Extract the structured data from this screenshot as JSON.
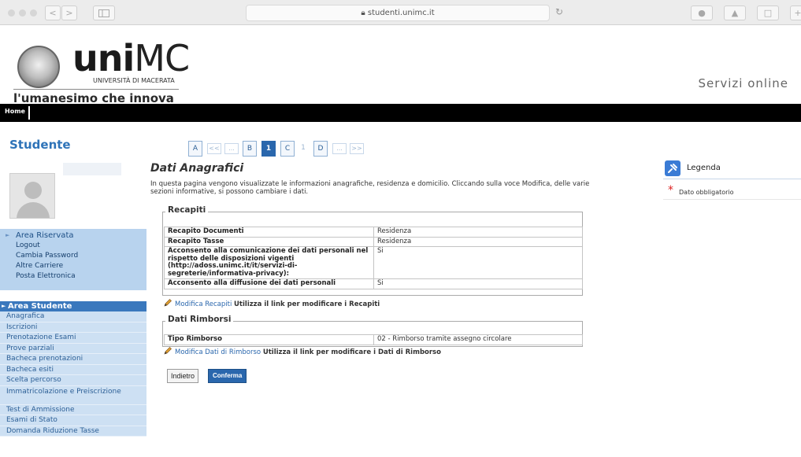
{
  "browser": {
    "url": "studenti.unimc.it",
    "reload_icon": "reload-icon",
    "back_label": "<",
    "forward_label": ">"
  },
  "header": {
    "logo_bold": "uni",
    "logo_light": "MC",
    "logo_sub": "UNIVERSITÀ DI MACERATA",
    "tagline": "l'umanesimo che innova",
    "servizi": "Servizi online"
  },
  "topnav": {
    "home": "Home"
  },
  "sidebar": {
    "title": "Studente",
    "area_riservata": {
      "title": "Area Riservata",
      "items": [
        "Logout",
        "Cambia Password",
        "Altre Carriere",
        "Posta Elettronica"
      ]
    },
    "area_studente": {
      "title": "Area Studente",
      "items": [
        "Anagrafica",
        "Iscrizioni",
        "Prenotazione Esami",
        "Prove parziali",
        "Bacheca prenotazioni",
        "Bacheca esiti",
        "Scelta percorso",
        "Immatricolazione e Preiscrizione",
        "Test di Ammissione",
        "Esami di Stato",
        "Domanda Riduzione Tasse"
      ]
    }
  },
  "pager": {
    "steps": [
      "A",
      "<<",
      "...",
      "B",
      "1",
      "C",
      "1",
      "D",
      "...",
      ">>"
    ],
    "active": "1"
  },
  "main": {
    "title": "Dati Anagrafici",
    "intro": "In questa pagina vengono visualizzate le informazioni anagrafiche, residenza e domicilio. Cliccando sulla voce Modifica, delle varie sezioni informative, si possono cambiare i dati.",
    "recapiti": {
      "legend": "Recapiti",
      "rows": [
        {
          "label": "Recapito Documenti",
          "value": "Residenza"
        },
        {
          "label": "Recapito Tasse",
          "value": "Residenza"
        },
        {
          "label": "Acconsento alla comunicazione dei dati personali nel rispetto delle disposizioni vigenti (http://adoss.unimc.it/it/servizi-di-segreterie/informativa-privacy):",
          "value": "Si"
        },
        {
          "label": "Acconsento alla diffusione dei dati personali",
          "value": "Si"
        }
      ],
      "edit_link": "Modifica Recapiti",
      "edit_hint": "Utilizza il link per modificare i Recapiti"
    },
    "rimborsi": {
      "legend": "Dati Rimborsi",
      "rows": [
        {
          "label": "Tipo Rimborso",
          "value": "02 - Rimborso tramite assegno circolare"
        }
      ],
      "edit_link": "Modifica Dati di Rimborso",
      "edit_hint": "Utilizza il link per modificare i Dati di Rimborso"
    },
    "back_button": "Indietro",
    "confirm_button": "Conferma"
  },
  "legend_panel": {
    "title": "Legenda",
    "required": "Dato obbligatorio",
    "icon": "legend-icon"
  },
  "colors": {
    "accent": "#2a67ad",
    "sidebar_light": "#cde0f3",
    "area_riservata_bg": "#b8d3ee",
    "required_star": "#dd2222"
  }
}
